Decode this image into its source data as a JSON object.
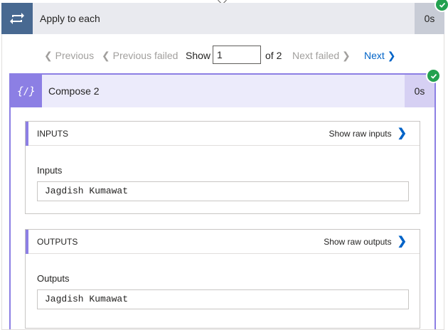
{
  "apply": {
    "title": "Apply to each",
    "duration": "0s",
    "icon": "loop-icon"
  },
  "pager": {
    "previous": "Previous",
    "previous_failed": "Previous failed",
    "show": "Show",
    "current": "1",
    "of_total": "of 2",
    "next_failed": "Next failed",
    "next": "Next"
  },
  "compose": {
    "title": "Compose 2",
    "duration": "0s",
    "icon": "compose-expression-icon"
  },
  "inputs": {
    "header": "INPUTS",
    "raw_link": "Show raw inputs",
    "label": "Inputs",
    "value": "Jagdish Kumawat"
  },
  "outputs": {
    "header": "OUTPUTS",
    "raw_link": "Show raw outputs",
    "label": "Outputs",
    "value": "Jagdish Kumawat"
  },
  "colors": {
    "apply_icon_bg": "#486991",
    "compose_accent": "#8c7fe4",
    "success": "#23a14f",
    "link": "#0063c7"
  }
}
